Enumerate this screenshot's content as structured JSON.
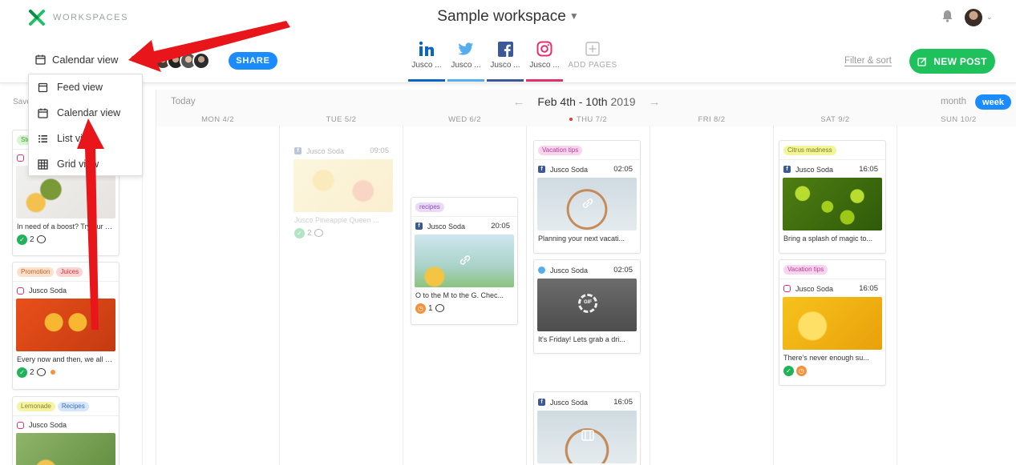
{
  "brand": {
    "name": "WORKSPACES"
  },
  "workspace": {
    "title": "Sample workspace"
  },
  "view_selector": {
    "label": "Calendar view"
  },
  "share": {
    "label": "SHARE"
  },
  "pages": [
    {
      "network": "linkedin",
      "label": "Jusco ...",
      "bar": "#0a66c2"
    },
    {
      "network": "twitter",
      "label": "Jusco ...",
      "bar": "#55acee"
    },
    {
      "network": "facebook",
      "label": "Jusco ...",
      "bar": "#3b5998"
    },
    {
      "network": "instagram",
      "label": "Jusco ...",
      "bar": "#e1306c"
    }
  ],
  "add_pages": {
    "label": "ADD PAGES"
  },
  "filter": {
    "label": "Filter & sort"
  },
  "new_post": {
    "label": "NEW POST"
  },
  "sidebar": {
    "header": "Save"
  },
  "dropdown": {
    "items": [
      {
        "label": "Feed view",
        "icon": "feed-icon"
      },
      {
        "label": "Calendar view",
        "icon": "calendar-icon"
      },
      {
        "label": "List view",
        "icon": "list-icon"
      },
      {
        "label": "Grid view",
        "icon": "grid-icon"
      }
    ]
  },
  "calendar": {
    "today": "Today",
    "range": "Feb 4th - 10th",
    "year": "2019",
    "month_label": "month",
    "week_label": "week",
    "days": [
      "MON 4/2",
      "TUE 5/2",
      "WED 6/2",
      "THU 7/2",
      "FRI 8/2",
      "SAT 9/2",
      "SUN 10/2"
    ]
  },
  "cards": {
    "s1": {
      "tag": "Sto",
      "text": "In need of a boost? Try our de...",
      "count": "2"
    },
    "s2": {
      "tags": [
        "Promotion",
        "Juices"
      ],
      "account": "Jusco Soda",
      "text": "Every now and then, we all ne...",
      "count": "2"
    },
    "s3": {
      "tags": [
        "Lemonade",
        "Recipes"
      ],
      "account": "Jusco Soda"
    },
    "tue": {
      "account": "Jusco Soda",
      "time": "09:05",
      "text": "Jusco Pineapple Queen ...",
      "count": "2"
    },
    "wed": {
      "tag": "recipes",
      "account": "Jusco Soda",
      "time": "20:05",
      "text": "O to the M to the G. Chec...",
      "count": "1"
    },
    "thu1": {
      "tag": "Vacation tips",
      "account": "Jusco Soda",
      "time": "02:05",
      "text": "Planning your next vacati..."
    },
    "thu2": {
      "account": "Jusco Soda",
      "time": "02:05",
      "text": "It's Friday! Lets grab a dri...",
      "gif": "GIF"
    },
    "thu3": {
      "account": "Jusco Soda",
      "time": "16:05"
    },
    "sat1": {
      "tag": "Citrus madness",
      "account": "Jusco Soda",
      "time": "16:05",
      "text": "Bring a splash of magic to..."
    },
    "sat2": {
      "tag": "Vacation tips",
      "account": "Jusco Soda",
      "time": "16:05",
      "text": "There's never enough su..."
    }
  },
  "colors": {
    "accent": "#1a8cff",
    "new_post": "#1ec15c",
    "annotation_arrow": "#e8161b"
  }
}
